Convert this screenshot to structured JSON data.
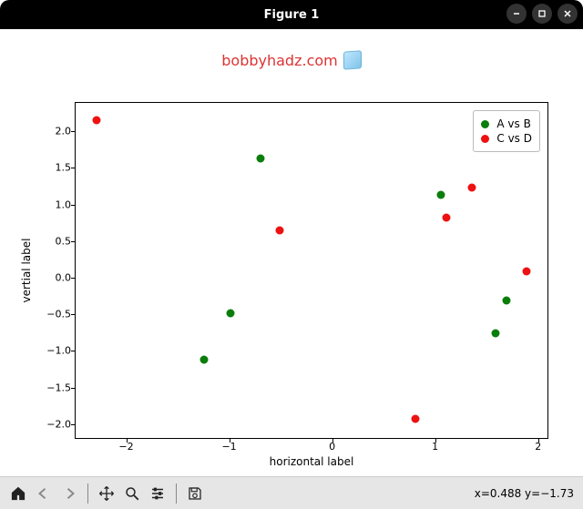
{
  "window": {
    "title": "Figure 1"
  },
  "chart_data": {
    "type": "scatter",
    "title": "bobbyhadz.com",
    "xlabel": "horizontal label",
    "ylabel": "vertial label",
    "xlim": [
      -2.5,
      2.1
    ],
    "ylim": [
      -2.2,
      2.4
    ],
    "xticks": [
      -2,
      -1,
      0,
      1,
      2
    ],
    "yticks": [
      -2.0,
      -1.5,
      -1.0,
      -0.5,
      0.0,
      0.5,
      1.0,
      1.5,
      2.0
    ],
    "series": [
      {
        "name": "A vs B",
        "color": "#0a7d0a",
        "points": [
          {
            "x": -1.25,
            "y": -1.1
          },
          {
            "x": -1.0,
            "y": -0.47
          },
          {
            "x": -0.7,
            "y": 1.64
          },
          {
            "x": 1.05,
            "y": 1.15
          },
          {
            "x": 1.58,
            "y": -0.75
          },
          {
            "x": 1.68,
            "y": -0.3
          }
        ]
      },
      {
        "name": "C vs D",
        "color": "#e11",
        "points": [
          {
            "x": -2.3,
            "y": 2.17
          },
          {
            "x": -0.52,
            "y": 0.66
          },
          {
            "x": 0.8,
            "y": -1.92
          },
          {
            "x": 1.1,
            "y": 0.83
          },
          {
            "x": 1.35,
            "y": 1.25
          },
          {
            "x": 1.88,
            "y": 0.1
          }
        ]
      }
    ]
  },
  "legend": {
    "items": [
      "A vs B",
      "C vs D"
    ]
  },
  "toolbar": {
    "coord_readout": "x=0.488 y=−1.73"
  }
}
